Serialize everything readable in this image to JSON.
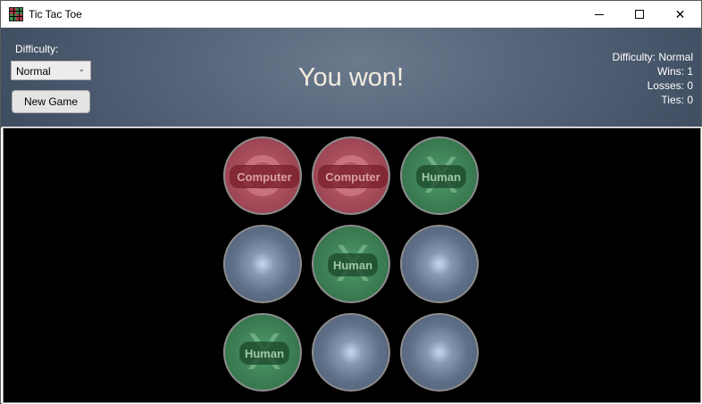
{
  "window": {
    "title": "Tic Tac Toe"
  },
  "header": {
    "difficulty_label": "Difficulty:",
    "difficulty_selected": "Normal",
    "new_game_label": "New Game",
    "status": "You won!",
    "stats": {
      "difficulty": "Difficulty: Normal",
      "wins": "Wins: 1",
      "losses": "Losses: 0",
      "ties": "Ties: 0"
    }
  },
  "board": {
    "cells": [
      {
        "state": "computer",
        "mark": "O",
        "label": "Computer"
      },
      {
        "state": "computer",
        "mark": "O",
        "label": "Computer"
      },
      {
        "state": "human",
        "mark": "X",
        "label": "Human"
      },
      {
        "state": "empty",
        "mark": "",
        "label": ""
      },
      {
        "state": "human",
        "mark": "X",
        "label": "Human"
      },
      {
        "state": "empty",
        "mark": "",
        "label": ""
      },
      {
        "state": "human",
        "mark": "X",
        "label": "Human"
      },
      {
        "state": "empty",
        "mark": "",
        "label": ""
      },
      {
        "state": "empty",
        "mark": "",
        "label": ""
      }
    ]
  },
  "colors": {
    "human": "#3c7e54",
    "computer": "#a44a58",
    "empty": "#5f7089",
    "board_bg": "#000000"
  }
}
